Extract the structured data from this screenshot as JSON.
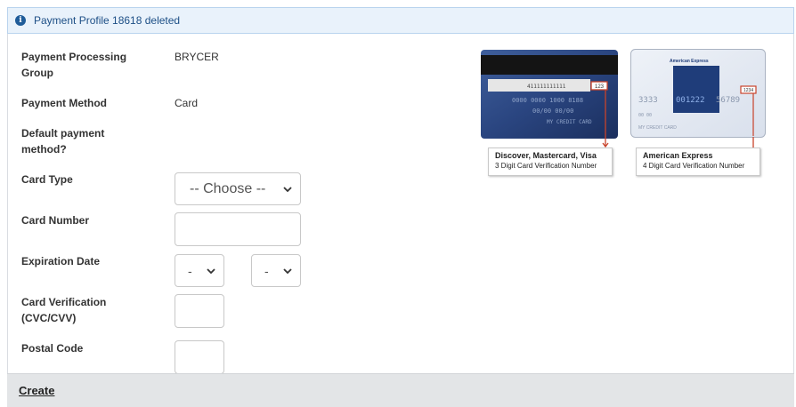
{
  "alert": {
    "message": "Payment Profile 18618 deleted",
    "icon": "info-icon"
  },
  "form": {
    "processing_group_label": "Payment Processing Group",
    "processing_group_value": "BRYCER",
    "payment_method_label": "Payment Method",
    "payment_method_value": "Card",
    "default_label": "Default payment method?",
    "card_type_label": "Card Type",
    "card_type_selected": "-- Choose --",
    "card_number_label": "Card Number",
    "card_number_value": "",
    "expiration_label": "Expiration Date",
    "exp_month_selected": "-",
    "exp_year_selected": "-",
    "cvv_label": "Card Verification (CVC/CVV)",
    "cvv_value": "",
    "postal_label": "Postal Code",
    "postal_value": ""
  },
  "cards": {
    "visa": {
      "brands": "Discover, Mastercard, Visa",
      "hint": "3 Digit Card Verification Number",
      "code": "123"
    },
    "amex": {
      "title": "American Express",
      "number_left": "3333",
      "number_mid": "001222",
      "number_right": "56789",
      "code": "1234",
      "date": "00 00",
      "holder": "MY CREDIT CARD",
      "brand": "American Express",
      "hint": "4 Digit Card Verification Number"
    }
  },
  "footer": {
    "create_label": "Create"
  },
  "colors": {
    "alert_bg": "#e9f2fb",
    "alert_text": "#1d4f86",
    "footer_bg": "#e3e5e7",
    "arrow": "#c8432b"
  }
}
